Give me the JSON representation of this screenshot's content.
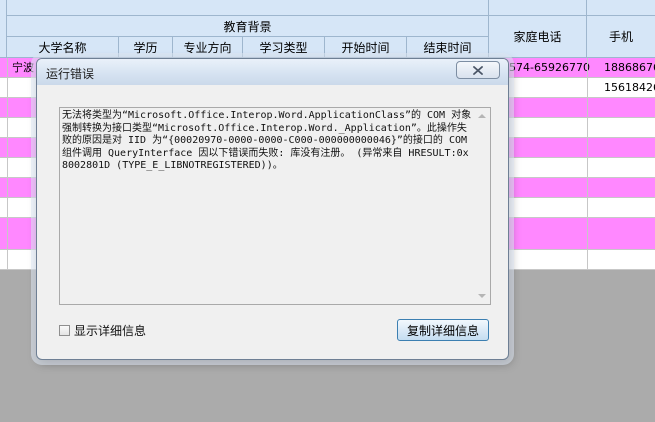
{
  "table": {
    "group_header": "教育背景",
    "columns": [
      "大学名称",
      "学历",
      "专业方向",
      "学习类型",
      "开始时间",
      "结束时间"
    ],
    "phone_header": "家庭电话",
    "mobile_header": "手机",
    "rows": [
      {
        "university": "宁波",
        "home_phone": "574-65926770",
        "mobile": "18868676"
      },
      {
        "university": "",
        "home_phone": "",
        "mobile": "15618426"
      }
    ]
  },
  "dialog": {
    "title": "运行错误",
    "message": "无法将类型为“Microsoft.Office.Interop.Word.ApplicationClass”的 COM 对象强制转换为接口类型“Microsoft.Office.Interop.Word._Application”。此操作失败的原因是对 IID 为“{00020970-0000-0000-C000-000000000046}”的接口的 COM 组件调用 QueryInterface 因以下错误而失败: 库没有注册。 (异常来自 HRESULT:0x8002801D (TYPE_E_LIBNOTREGISTERED))。",
    "checkbox_label": "显示详细信息",
    "copy_button": "复制详细信息"
  },
  "colors": {
    "header_bg": "#d6e6f7",
    "row_highlight": "#ff88ff",
    "app_bg": "#ababab"
  },
  "icons": {
    "close": "close-icon"
  }
}
